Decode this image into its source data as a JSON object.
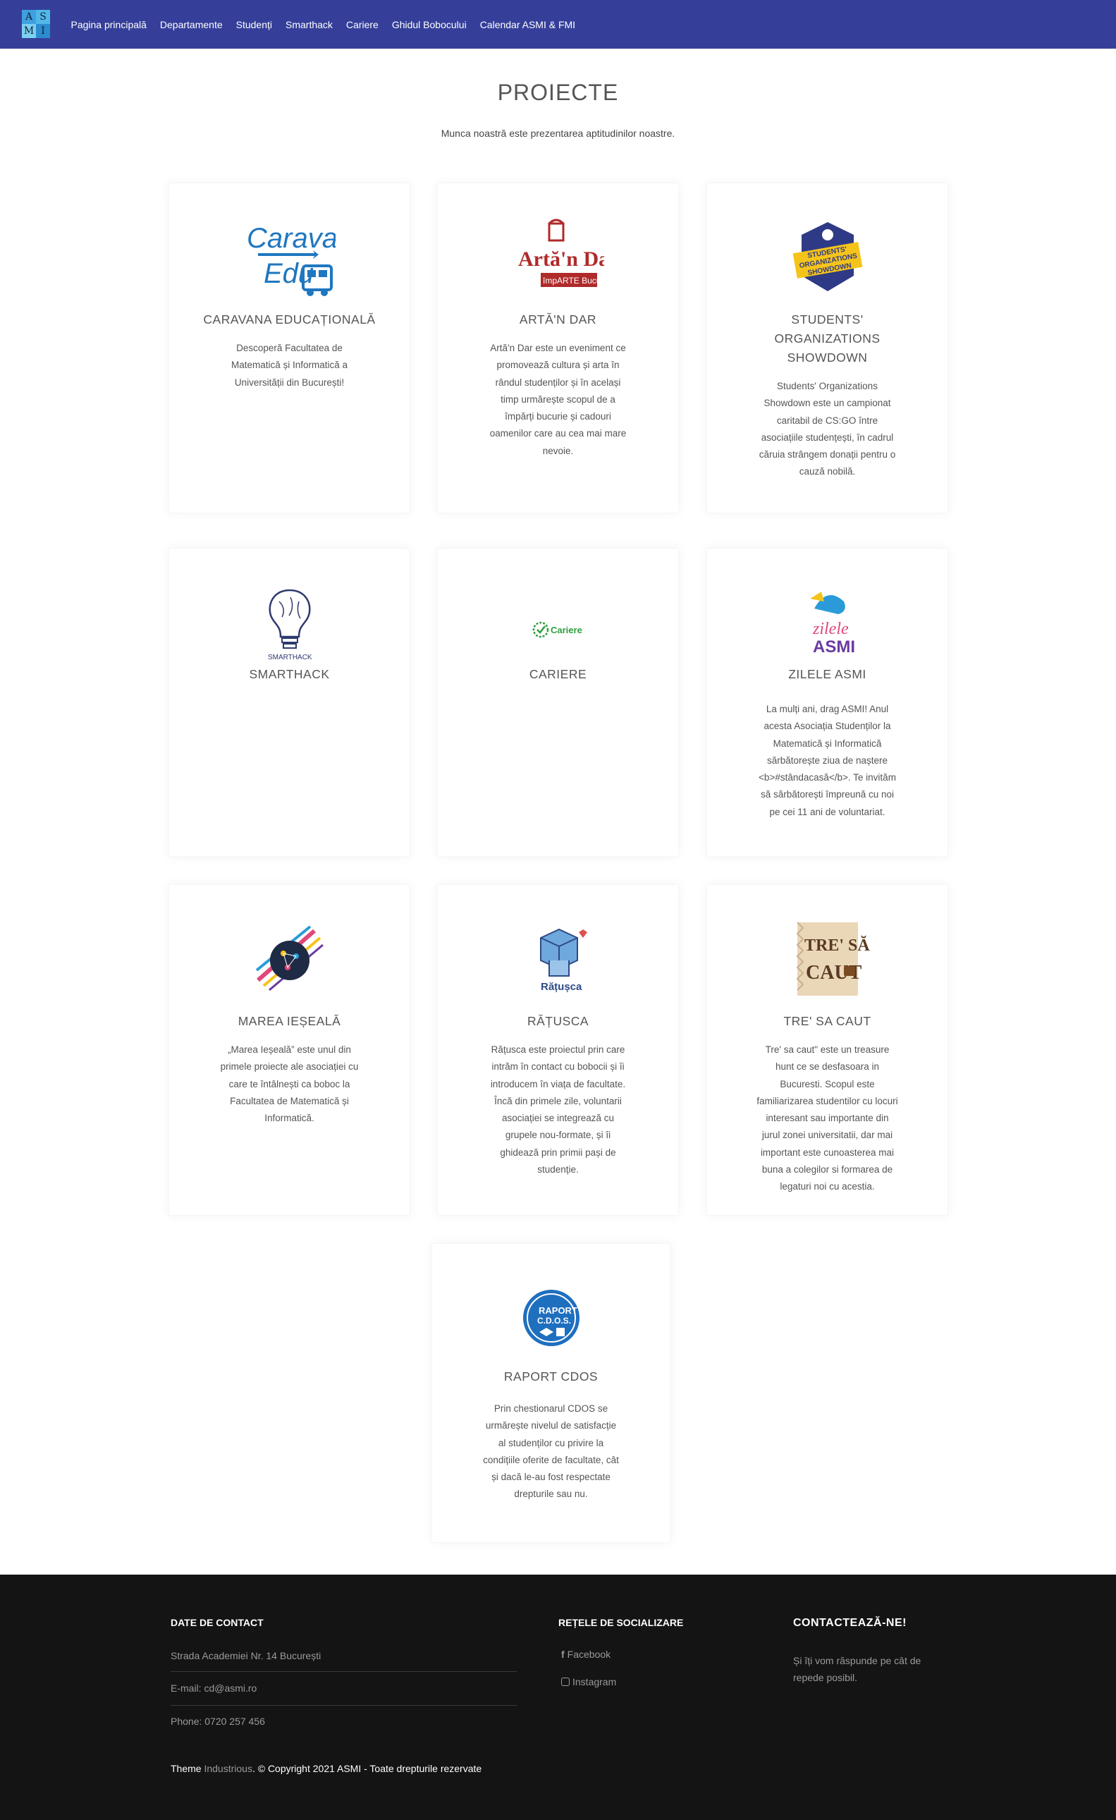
{
  "nav": {
    "logo_letters": [
      "A",
      "S",
      "M",
      "I"
    ],
    "links": [
      "Pagina principală",
      "Departamente",
      "Studenți",
      "Smarthack",
      "Cariere",
      "Ghidul Bobocului",
      "Calendar ASMI & FMI"
    ]
  },
  "header": {
    "title": "PROIECTE",
    "subtitle": "Munca noastră este prezentarea aptitudinilor noastre."
  },
  "projects": [
    {
      "title": "CARAVANA EDUCAȚIONALĂ",
      "logo_text": [
        "Caravana",
        "Edu"
      ],
      "icon": "caravana-edu-logo",
      "description": "Descoperă Facultatea de Matematică și Informatică a Universității din București!"
    },
    {
      "title": "ARTĂ'N DAR",
      "logo_text": [
        "Artă'n Dar",
        "împARTE Bucurie"
      ],
      "icon": "arta-n-dar-logo",
      "description": "Artă'n Dar este un eveniment ce promovează cultura și arta în rândul studenților și în același timp urmărește scopul de a împărți bucurie și cadouri oamenilor care au cea mai mare nevoie."
    },
    {
      "title": "STUDENTS' ORGANIZATIONS SHOWDOWN",
      "logo_text": [
        "STUDENTS'",
        "ORGANIZATIONS",
        "SHOWDOWN"
      ],
      "icon": "showdown-shield-logo",
      "description": "Students' Organizations Showdown este un campionat caritabil de CS:GO între asociațiile studențești, în cadrul căruia strângem donații pentru o cauză nobilă."
    },
    {
      "title": "SMARTHACK",
      "logo_text": [
        "SMARTHACK"
      ],
      "icon": "smarthack-bulb-logo",
      "description": ""
    },
    {
      "title": "CARIERE",
      "logo_text": [
        "Cariere"
      ],
      "icon": "cariere-check-logo",
      "description": ""
    },
    {
      "title": "ZILELE ASMI",
      "logo_text": [
        "zilele",
        "ASMI"
      ],
      "icon": "zilele-asmi-logo",
      "description": "La mulți ani, drag ASMI! Anul acesta Asociația Studenților la Matematică și Informatică sărbătorește ziua de naștere <b>#stândacasă</b>. Te invităm să sărbătorești împreună cu noi pe cei 11 ani de voluntariat."
    },
    {
      "title": "MAREA IEȘEALĂ",
      "logo_text": [],
      "icon": "marea-iesea-logo",
      "description": "„Marea Ieșeală” este unul din primele proiecte ale asociației cu care te întâlnești ca boboc la Facultatea de Matematică și Informatică."
    },
    {
      "title": "RĂȚUSCA",
      "logo_text": [
        "Rățușca"
      ],
      "icon": "ratusca-logo",
      "description": "Rățusca este proiectul prin care intrăm în contact cu bobocii și îi introducem în viața de facultate. Încă din primele zile, voluntarii asociației se integrează cu grupele nou-formate, și îi ghidează prin primii pași de studenție."
    },
    {
      "title": "TRE' SA CAUT",
      "logo_text": [
        "TRE' SĂ",
        "CAUT"
      ],
      "icon": "tre-sa-caut-logo",
      "description": "Tre' sa caut\" este un treasure hunt ce se desfasoara in Bucuresti. Scopul este familiarizarea studentilor cu locuri interesant sau importante din jurul zonei universitatii, dar mai important este cunoasterea mai buna a colegilor si formarea de legaturi noi cu acestia."
    },
    {
      "title": "RAPORT CDOS",
      "logo_text": [
        "RAPORT",
        "C.D.O.S."
      ],
      "icon": "raport-cdos-logo",
      "description": "Prin chestionarul CDOS se urmărește nivelul de satisfacție al studenților cu privire la condițiile oferite de facultate, cât și dacă le-au fost respectate drepturile sau nu."
    }
  ],
  "footer": {
    "contact_heading": "DATE DE CONTACT",
    "address": "Strada Academiei Nr. 14 București",
    "email": "E-mail: cd@asmi.ro",
    "phone": "Phone: 0720 257 456",
    "social_heading": "REȚELE DE SOCIALIZARE",
    "facebook": "Facebook",
    "instagram": "Instagram",
    "cta_heading": "CONTACTEAZĂ-NE!",
    "cta_text": "Și îți vom răspunde pe cât de repede posibil.",
    "copyright_prefix": "Theme",
    "copyright_theme": "Industrious",
    "copyright_suffix": ". © Copyright 2021 ASMI - Toate drepturile rezervate"
  }
}
